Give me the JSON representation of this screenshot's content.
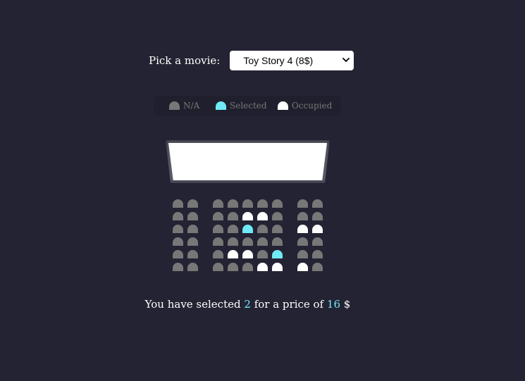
{
  "movie_picker": {
    "label": "Pick a movie:",
    "selected": "Toy Story 4 (8$)"
  },
  "legend": {
    "na": "N/A",
    "selected": "Selected",
    "occupied": "Occupied"
  },
  "colors": {
    "background": "#242333",
    "seat_na": "#777777",
    "seat_selected": "#6feaf6",
    "seat_occupied": "#ffffff"
  },
  "seats": [
    [
      "na",
      "na",
      "na",
      "na",
      "na",
      "na",
      "na",
      "na",
      "na",
      "na"
    ],
    [
      "na",
      "na",
      "na",
      "na",
      "occupied",
      "occupied",
      "na",
      "na",
      "na",
      "na"
    ],
    [
      "na",
      "na",
      "na",
      "na",
      "selected",
      "na",
      "na",
      "na",
      "occupied",
      "occupied"
    ],
    [
      "na",
      "na",
      "na",
      "na",
      "na",
      "na",
      "na",
      "na",
      "na",
      "na"
    ],
    [
      "na",
      "na",
      "na",
      "occupied",
      "occupied",
      "na",
      "selected",
      "na",
      "na",
      "na"
    ],
    [
      "na",
      "na",
      "na",
      "na",
      "na",
      "occupied",
      "occupied",
      "na",
      "occupied",
      "na"
    ]
  ],
  "summary": {
    "prefix": "You have selected",
    "count": "2",
    "middle": "for a price of",
    "price": "16",
    "currency": "$"
  }
}
